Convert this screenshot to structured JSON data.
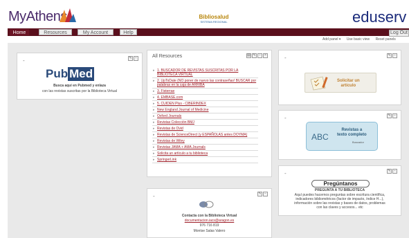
{
  "header": {
    "logo_text": "MyAthens",
    "partner_logo_main": "Bibliosalud",
    "partner_logo_sub": "SISTEMA  REGIONAL",
    "brand_text": "eduserv",
    "brand_color": "#1a2a7a"
  },
  "nav": {
    "tabs": [
      {
        "label": "Home",
        "active": true
      },
      {
        "label": "Resources",
        "active": false
      },
      {
        "label": "My Account",
        "active": false
      },
      {
        "label": "Help",
        "active": false
      }
    ],
    "logout_label": "Log Out",
    "bar_color": "#5a0f1c"
  },
  "toolbar": {
    "add_panel": "Add panel ▾",
    "basic_view": "Use basic view",
    "reset_panels": "Reset panels"
  },
  "pubmed_panel": {
    "title_icon": "-",
    "logo_part1": "Pub",
    "logo_part2": "Med",
    "line1": "Busca aquí en Pubmed y enlaza",
    "line2": "con las revistas suscritas por la Biblioteca Virtual"
  },
  "resources_panel": {
    "title": "All Resources",
    "items": [
      "1. BUSCADOR DE REVISTAS SUSCRITAS POR LA BIBLIOTECA VIRTUAL",
      "2. UpToDate (NO poner de nuevo las contraseñas! BUSCAR por palabras en la caja de ARRIBA",
      "3. Fisterrae",
      "4. EMBASE.com",
      "5. CUIDEN Plus - CIBERINDEX",
      "New England Journal of Medicine",
      "Oxford Journals",
      "Revistas Colección BMJ",
      "Revistas de Ovid",
      "Revistas de ScienceDirect (y ESPAÑOLAS antes DOYMA)",
      "Revistas de Wiley",
      "Revistas JAMA + AMA Journals",
      "Solicita un artículo a tu biblioteca",
      "SpringerLink"
    ]
  },
  "contact_panel": {
    "title_icon": "-",
    "line1": "Contacta con la Biblioteca Virtual",
    "email": "documentacion.iacs@aragon.es",
    "phone": "976 716 819",
    "name": "Montse Salas Valero"
  },
  "solicitar_panel": {
    "title_icon": "-",
    "line1": "Solicitar un",
    "line2": "artículo"
  },
  "revistas_panel": {
    "title_icon": "-",
    "abc": "ABC",
    "line1": "Revistas a",
    "line2": "texto completo",
    "line3": "Buscador"
  },
  "preguntanos_panel": {
    "title_icon": "-",
    "button": "Pregúntanos",
    "subtitle": "PREGUNTA A TU BIBLIOTECA",
    "lines": [
      "Aquí puedes hacernos preguntas sobre escritura científica,",
      "indicadores bibliométricos (factor de impacto, índice H...),",
      "información sobre las revistas y bases de datos, problemas",
      "con las claves y accesos... etc"
    ]
  },
  "panel_controls": {
    "edit": "✎",
    "min": "−",
    "close": "×",
    "rss": "▤"
  }
}
